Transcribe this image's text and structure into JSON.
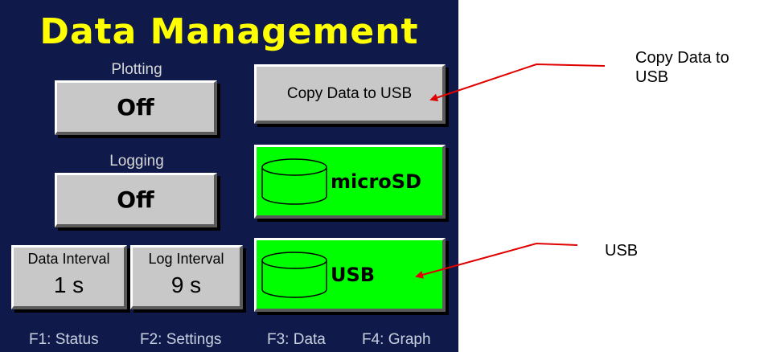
{
  "screen": {
    "title": "Data Management",
    "plotting": {
      "label": "Plotting",
      "value": "Off"
    },
    "logging": {
      "label": "Logging",
      "value": "Off"
    },
    "data_interval": {
      "label": "Data Interval",
      "value": "1 s"
    },
    "log_interval": {
      "label": "Log Interval",
      "value": "9 s"
    },
    "copy_button": "Copy Data to USB",
    "microsd_button": {
      "label": "microSD",
      "icon": "drive-icon"
    },
    "usb_button": {
      "label": "USB",
      "icon": "drive-icon"
    },
    "function_keys": [
      "F1: Status",
      "F2: Settings",
      "F3: Data",
      "F4: Graph"
    ]
  },
  "annotations": {
    "copy_line1": "Copy Data to",
    "copy_line2": "USB",
    "usb": "USB"
  },
  "colors": {
    "screen_bg": "#0f1a4a",
    "title": "#ffff00",
    "button_gray": "#c8c8c8",
    "button_green": "#00ff00",
    "arrow": "#e00000"
  }
}
